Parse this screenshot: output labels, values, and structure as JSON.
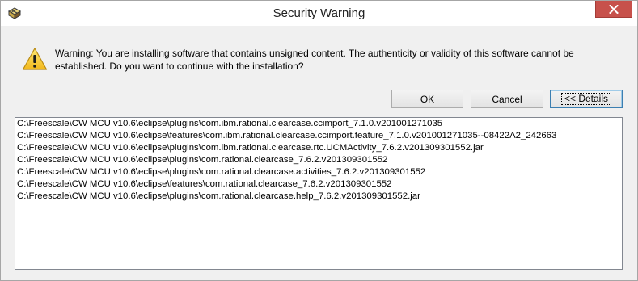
{
  "window": {
    "title": "Security Warning",
    "app_icon": "puzzle-cube-icon",
    "close_icon": "close-icon",
    "close_color": "#c7514b"
  },
  "dialog": {
    "warning_icon": "warning-icon",
    "message_line1": "Warning: You are installing software that contains unsigned content. The authenticity or validity of this software cannot be",
    "message_line2": "established. Do you want to continue with the installation?",
    "ok_label": "OK",
    "cancel_label": "Cancel",
    "details_label": "<< Details"
  },
  "details": {
    "paths": [
      "C:\\Freescale\\CW MCU v10.6\\eclipse\\plugins\\com.ibm.rational.clearcase.ccimport_7.1.0.v201001271035",
      "C:\\Freescale\\CW MCU v10.6\\eclipse\\features\\com.ibm.rational.clearcase.ccimport.feature_7.1.0.v201001271035--08422A2_242663",
      "C:\\Freescale\\CW MCU v10.6\\eclipse\\plugins\\com.ibm.rational.clearcase.rtc.UCMActivity_7.6.2.v201309301552.jar",
      "C:\\Freescale\\CW MCU v10.6\\eclipse\\plugins\\com.rational.clearcase_7.6.2.v201309301552",
      "C:\\Freescale\\CW MCU v10.6\\eclipse\\plugins\\com.rational.clearcase.activities_7.6.2.v201309301552",
      "C:\\Freescale\\CW MCU v10.6\\eclipse\\features\\com.rational.clearcase_7.6.2.v201309301552",
      "C:\\Freescale\\CW MCU v10.6\\eclipse\\plugins\\com.rational.clearcase.help_7.6.2.v201309301552.jar"
    ]
  }
}
